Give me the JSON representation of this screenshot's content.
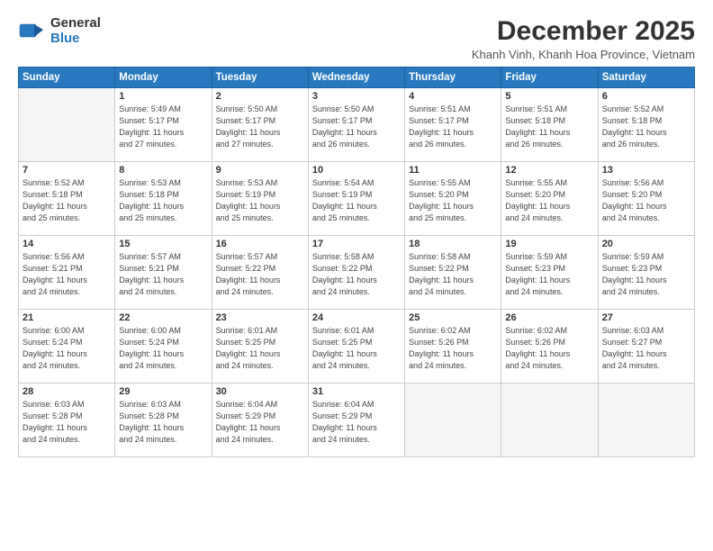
{
  "header": {
    "logo_general": "General",
    "logo_blue": "Blue",
    "month_title": "December 2025",
    "subtitle": "Khanh Vinh, Khanh Hoa Province, Vietnam"
  },
  "weekdays": [
    "Sunday",
    "Monday",
    "Tuesday",
    "Wednesday",
    "Thursday",
    "Friday",
    "Saturday"
  ],
  "weeks": [
    [
      {
        "day": "",
        "info": ""
      },
      {
        "day": "1",
        "info": "Sunrise: 5:49 AM\nSunset: 5:17 PM\nDaylight: 11 hours\nand 27 minutes."
      },
      {
        "day": "2",
        "info": "Sunrise: 5:50 AM\nSunset: 5:17 PM\nDaylight: 11 hours\nand 27 minutes."
      },
      {
        "day": "3",
        "info": "Sunrise: 5:50 AM\nSunset: 5:17 PM\nDaylight: 11 hours\nand 26 minutes."
      },
      {
        "day": "4",
        "info": "Sunrise: 5:51 AM\nSunset: 5:17 PM\nDaylight: 11 hours\nand 26 minutes."
      },
      {
        "day": "5",
        "info": "Sunrise: 5:51 AM\nSunset: 5:18 PM\nDaylight: 11 hours\nand 26 minutes."
      },
      {
        "day": "6",
        "info": "Sunrise: 5:52 AM\nSunset: 5:18 PM\nDaylight: 11 hours\nand 26 minutes."
      }
    ],
    [
      {
        "day": "7",
        "info": "Sunrise: 5:52 AM\nSunset: 5:18 PM\nDaylight: 11 hours\nand 25 minutes."
      },
      {
        "day": "8",
        "info": "Sunrise: 5:53 AM\nSunset: 5:18 PM\nDaylight: 11 hours\nand 25 minutes."
      },
      {
        "day": "9",
        "info": "Sunrise: 5:53 AM\nSunset: 5:19 PM\nDaylight: 11 hours\nand 25 minutes."
      },
      {
        "day": "10",
        "info": "Sunrise: 5:54 AM\nSunset: 5:19 PM\nDaylight: 11 hours\nand 25 minutes."
      },
      {
        "day": "11",
        "info": "Sunrise: 5:55 AM\nSunset: 5:20 PM\nDaylight: 11 hours\nand 25 minutes."
      },
      {
        "day": "12",
        "info": "Sunrise: 5:55 AM\nSunset: 5:20 PM\nDaylight: 11 hours\nand 24 minutes."
      },
      {
        "day": "13",
        "info": "Sunrise: 5:56 AM\nSunset: 5:20 PM\nDaylight: 11 hours\nand 24 minutes."
      }
    ],
    [
      {
        "day": "14",
        "info": "Sunrise: 5:56 AM\nSunset: 5:21 PM\nDaylight: 11 hours\nand 24 minutes."
      },
      {
        "day": "15",
        "info": "Sunrise: 5:57 AM\nSunset: 5:21 PM\nDaylight: 11 hours\nand 24 minutes."
      },
      {
        "day": "16",
        "info": "Sunrise: 5:57 AM\nSunset: 5:22 PM\nDaylight: 11 hours\nand 24 minutes."
      },
      {
        "day": "17",
        "info": "Sunrise: 5:58 AM\nSunset: 5:22 PM\nDaylight: 11 hours\nand 24 minutes."
      },
      {
        "day": "18",
        "info": "Sunrise: 5:58 AM\nSunset: 5:22 PM\nDaylight: 11 hours\nand 24 minutes."
      },
      {
        "day": "19",
        "info": "Sunrise: 5:59 AM\nSunset: 5:23 PM\nDaylight: 11 hours\nand 24 minutes."
      },
      {
        "day": "20",
        "info": "Sunrise: 5:59 AM\nSunset: 5:23 PM\nDaylight: 11 hours\nand 24 minutes."
      }
    ],
    [
      {
        "day": "21",
        "info": "Sunrise: 6:00 AM\nSunset: 5:24 PM\nDaylight: 11 hours\nand 24 minutes."
      },
      {
        "day": "22",
        "info": "Sunrise: 6:00 AM\nSunset: 5:24 PM\nDaylight: 11 hours\nand 24 minutes."
      },
      {
        "day": "23",
        "info": "Sunrise: 6:01 AM\nSunset: 5:25 PM\nDaylight: 11 hours\nand 24 minutes."
      },
      {
        "day": "24",
        "info": "Sunrise: 6:01 AM\nSunset: 5:25 PM\nDaylight: 11 hours\nand 24 minutes."
      },
      {
        "day": "25",
        "info": "Sunrise: 6:02 AM\nSunset: 5:26 PM\nDaylight: 11 hours\nand 24 minutes."
      },
      {
        "day": "26",
        "info": "Sunrise: 6:02 AM\nSunset: 5:26 PM\nDaylight: 11 hours\nand 24 minutes."
      },
      {
        "day": "27",
        "info": "Sunrise: 6:03 AM\nSunset: 5:27 PM\nDaylight: 11 hours\nand 24 minutes."
      }
    ],
    [
      {
        "day": "28",
        "info": "Sunrise: 6:03 AM\nSunset: 5:28 PM\nDaylight: 11 hours\nand 24 minutes."
      },
      {
        "day": "29",
        "info": "Sunrise: 6:03 AM\nSunset: 5:28 PM\nDaylight: 11 hours\nand 24 minutes."
      },
      {
        "day": "30",
        "info": "Sunrise: 6:04 AM\nSunset: 5:29 PM\nDaylight: 11 hours\nand 24 minutes."
      },
      {
        "day": "31",
        "info": "Sunrise: 6:04 AM\nSunset: 5:29 PM\nDaylight: 11 hours\nand 24 minutes."
      },
      {
        "day": "",
        "info": ""
      },
      {
        "day": "",
        "info": ""
      },
      {
        "day": "",
        "info": ""
      }
    ]
  ]
}
